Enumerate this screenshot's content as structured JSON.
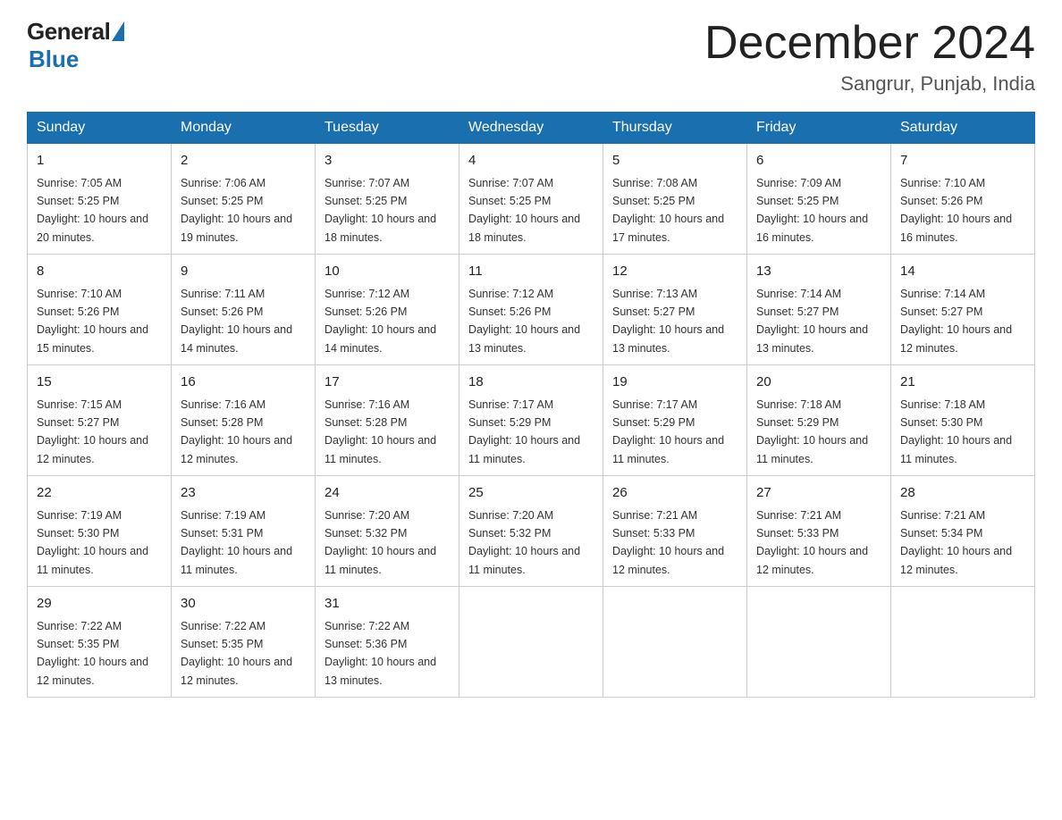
{
  "header": {
    "logo_general": "General",
    "logo_blue": "Blue",
    "month_title": "December 2024",
    "location": "Sangrur, Punjab, India"
  },
  "days_of_week": [
    "Sunday",
    "Monday",
    "Tuesday",
    "Wednesday",
    "Thursday",
    "Friday",
    "Saturday"
  ],
  "weeks": [
    [
      {
        "day": "1",
        "sunrise": "7:05 AM",
        "sunset": "5:25 PM",
        "daylight": "10 hours and 20 minutes."
      },
      {
        "day": "2",
        "sunrise": "7:06 AM",
        "sunset": "5:25 PM",
        "daylight": "10 hours and 19 minutes."
      },
      {
        "day": "3",
        "sunrise": "7:07 AM",
        "sunset": "5:25 PM",
        "daylight": "10 hours and 18 minutes."
      },
      {
        "day": "4",
        "sunrise": "7:07 AM",
        "sunset": "5:25 PM",
        "daylight": "10 hours and 18 minutes."
      },
      {
        "day": "5",
        "sunrise": "7:08 AM",
        "sunset": "5:25 PM",
        "daylight": "10 hours and 17 minutes."
      },
      {
        "day": "6",
        "sunrise": "7:09 AM",
        "sunset": "5:25 PM",
        "daylight": "10 hours and 16 minutes."
      },
      {
        "day": "7",
        "sunrise": "7:10 AM",
        "sunset": "5:26 PM",
        "daylight": "10 hours and 16 minutes."
      }
    ],
    [
      {
        "day": "8",
        "sunrise": "7:10 AM",
        "sunset": "5:26 PM",
        "daylight": "10 hours and 15 minutes."
      },
      {
        "day": "9",
        "sunrise": "7:11 AM",
        "sunset": "5:26 PM",
        "daylight": "10 hours and 14 minutes."
      },
      {
        "day": "10",
        "sunrise": "7:12 AM",
        "sunset": "5:26 PM",
        "daylight": "10 hours and 14 minutes."
      },
      {
        "day": "11",
        "sunrise": "7:12 AM",
        "sunset": "5:26 PM",
        "daylight": "10 hours and 13 minutes."
      },
      {
        "day": "12",
        "sunrise": "7:13 AM",
        "sunset": "5:27 PM",
        "daylight": "10 hours and 13 minutes."
      },
      {
        "day": "13",
        "sunrise": "7:14 AM",
        "sunset": "5:27 PM",
        "daylight": "10 hours and 13 minutes."
      },
      {
        "day": "14",
        "sunrise": "7:14 AM",
        "sunset": "5:27 PM",
        "daylight": "10 hours and 12 minutes."
      }
    ],
    [
      {
        "day": "15",
        "sunrise": "7:15 AM",
        "sunset": "5:27 PM",
        "daylight": "10 hours and 12 minutes."
      },
      {
        "day": "16",
        "sunrise": "7:16 AM",
        "sunset": "5:28 PM",
        "daylight": "10 hours and 12 minutes."
      },
      {
        "day": "17",
        "sunrise": "7:16 AM",
        "sunset": "5:28 PM",
        "daylight": "10 hours and 11 minutes."
      },
      {
        "day": "18",
        "sunrise": "7:17 AM",
        "sunset": "5:29 PM",
        "daylight": "10 hours and 11 minutes."
      },
      {
        "day": "19",
        "sunrise": "7:17 AM",
        "sunset": "5:29 PM",
        "daylight": "10 hours and 11 minutes."
      },
      {
        "day": "20",
        "sunrise": "7:18 AM",
        "sunset": "5:29 PM",
        "daylight": "10 hours and 11 minutes."
      },
      {
        "day": "21",
        "sunrise": "7:18 AM",
        "sunset": "5:30 PM",
        "daylight": "10 hours and 11 minutes."
      }
    ],
    [
      {
        "day": "22",
        "sunrise": "7:19 AM",
        "sunset": "5:30 PM",
        "daylight": "10 hours and 11 minutes."
      },
      {
        "day": "23",
        "sunrise": "7:19 AM",
        "sunset": "5:31 PM",
        "daylight": "10 hours and 11 minutes."
      },
      {
        "day": "24",
        "sunrise": "7:20 AM",
        "sunset": "5:32 PM",
        "daylight": "10 hours and 11 minutes."
      },
      {
        "day": "25",
        "sunrise": "7:20 AM",
        "sunset": "5:32 PM",
        "daylight": "10 hours and 11 minutes."
      },
      {
        "day": "26",
        "sunrise": "7:21 AM",
        "sunset": "5:33 PM",
        "daylight": "10 hours and 12 minutes."
      },
      {
        "day": "27",
        "sunrise": "7:21 AM",
        "sunset": "5:33 PM",
        "daylight": "10 hours and 12 minutes."
      },
      {
        "day": "28",
        "sunrise": "7:21 AM",
        "sunset": "5:34 PM",
        "daylight": "10 hours and 12 minutes."
      }
    ],
    [
      {
        "day": "29",
        "sunrise": "7:22 AM",
        "sunset": "5:35 PM",
        "daylight": "10 hours and 12 minutes."
      },
      {
        "day": "30",
        "sunrise": "7:22 AM",
        "sunset": "5:35 PM",
        "daylight": "10 hours and 12 minutes."
      },
      {
        "day": "31",
        "sunrise": "7:22 AM",
        "sunset": "5:36 PM",
        "daylight": "10 hours and 13 minutes."
      },
      null,
      null,
      null,
      null
    ]
  ],
  "labels": {
    "sunrise_prefix": "Sunrise: ",
    "sunset_prefix": "Sunset: ",
    "daylight_prefix": "Daylight: "
  }
}
